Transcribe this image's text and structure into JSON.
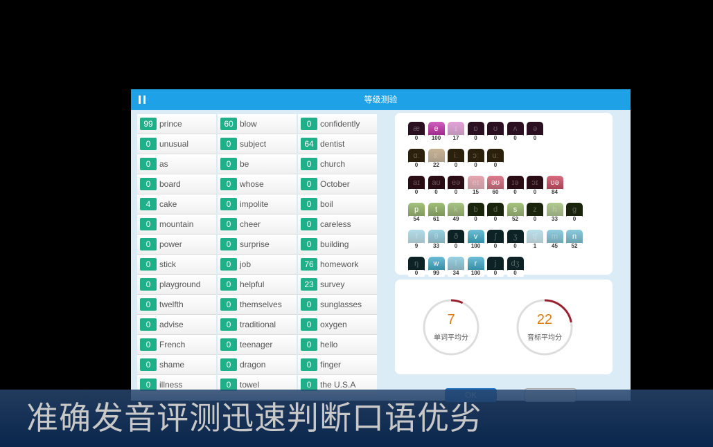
{
  "header": {
    "title": "等级测验"
  },
  "words": [
    [
      [
        "99",
        "prince"
      ],
      [
        "0",
        "unusual"
      ],
      [
        "0",
        "as"
      ],
      [
        "0",
        "board"
      ],
      [
        "4",
        "cake"
      ],
      [
        "0",
        "mountain"
      ],
      [
        "0",
        "power"
      ],
      [
        "0",
        "stick"
      ],
      [
        "0",
        "playground"
      ],
      [
        "0",
        "twelfth"
      ],
      [
        "0",
        "advise"
      ],
      [
        "0",
        "French"
      ],
      [
        "0",
        "shame"
      ],
      [
        "0",
        "illness"
      ]
    ],
    [
      [
        "60",
        "blow"
      ],
      [
        "0",
        "subject"
      ],
      [
        "0",
        "be"
      ],
      [
        "0",
        "whose"
      ],
      [
        "0",
        "impolite"
      ],
      [
        "0",
        "cheer"
      ],
      [
        "0",
        "surprise"
      ],
      [
        "0",
        "job"
      ],
      [
        "0",
        "helpful"
      ],
      [
        "0",
        "themselves"
      ],
      [
        "0",
        "traditional"
      ],
      [
        "0",
        "teenager"
      ],
      [
        "0",
        "dragon"
      ],
      [
        "0",
        "towel"
      ]
    ],
    [
      [
        "0",
        "confidently"
      ],
      [
        "64",
        "dentist"
      ],
      [
        "0",
        "church"
      ],
      [
        "0",
        "October"
      ],
      [
        "0",
        "boil"
      ],
      [
        "0",
        "careless"
      ],
      [
        "0",
        "building"
      ],
      [
        "76",
        "homework"
      ],
      [
        "23",
        "survey"
      ],
      [
        "0",
        "sunglasses"
      ],
      [
        "0",
        "oxygen"
      ],
      [
        "0",
        "hello"
      ],
      [
        "0",
        "finger"
      ],
      [
        "0",
        "the U.S.A"
      ]
    ]
  ],
  "phonemes": [
    {
      "color": "#c02aa8",
      "items": [
        [
          "æ",
          "0"
        ],
        [
          "e",
          "100"
        ],
        [
          "ɪ",
          "17"
        ],
        [
          "ɒ",
          "0"
        ],
        [
          "ʊ",
          "0"
        ],
        [
          "ʌ",
          "0"
        ],
        [
          "ə",
          "0"
        ]
      ]
    },
    {
      "color": "#8a5a1a",
      "items": [
        [
          "ɑː",
          "0"
        ],
        [
          "ɜː",
          "22"
        ],
        [
          "iː",
          "0"
        ],
        [
          "ɔː",
          "0"
        ],
        [
          "uː",
          "0"
        ]
      ]
    },
    {
      "color": "#c8304a",
      "items": [
        [
          "aɪ",
          "0"
        ],
        [
          "aʊ",
          "0"
        ],
        [
          "eə",
          "0"
        ],
        [
          "eɪ",
          "15"
        ],
        [
          "əʊ",
          "60"
        ],
        [
          "ɪə",
          "0"
        ],
        [
          "ɔɪ",
          "0"
        ],
        [
          "ʊə",
          "84"
        ]
      ]
    },
    {
      "color": "#6a9a2a",
      "items": [
        [
          "p",
          "54"
        ],
        [
          "t",
          "61"
        ],
        [
          "k",
          "49"
        ],
        [
          "b",
          "0"
        ],
        [
          "d",
          "0"
        ],
        [
          "s",
          "52"
        ],
        [
          "z",
          "0"
        ],
        [
          "h",
          "33"
        ],
        [
          "g",
          "0"
        ]
      ]
    },
    {
      "color": "#3aa8c8",
      "items": [
        [
          "f",
          "9"
        ],
        [
          "θ",
          "33"
        ],
        [
          "ð",
          "0"
        ],
        [
          "v",
          "100"
        ],
        [
          "ʃ",
          "0"
        ],
        [
          "ʒ",
          "0"
        ],
        [
          "tʃ",
          "1"
        ],
        [
          "m",
          "45"
        ],
        [
          "n",
          "52"
        ]
      ]
    },
    {
      "color": "#3aa8c8",
      "items": [
        [
          "ŋ",
          "0"
        ],
        [
          "w",
          "99"
        ],
        [
          "l",
          "34"
        ],
        [
          "r",
          "100"
        ],
        [
          "j",
          "0"
        ],
        [
          "dʒ",
          "0"
        ]
      ]
    }
  ],
  "scores": {
    "word_value": "7",
    "word_label": "单词平均分",
    "word_pct": 7,
    "phon_value": "22",
    "phon_label": "音标平均分",
    "phon_pct": 22,
    "ring_color": "#9a2030"
  },
  "buttons": {
    "ok": "OK"
  },
  "banner": "准确发音评测迅速判断口语优劣"
}
